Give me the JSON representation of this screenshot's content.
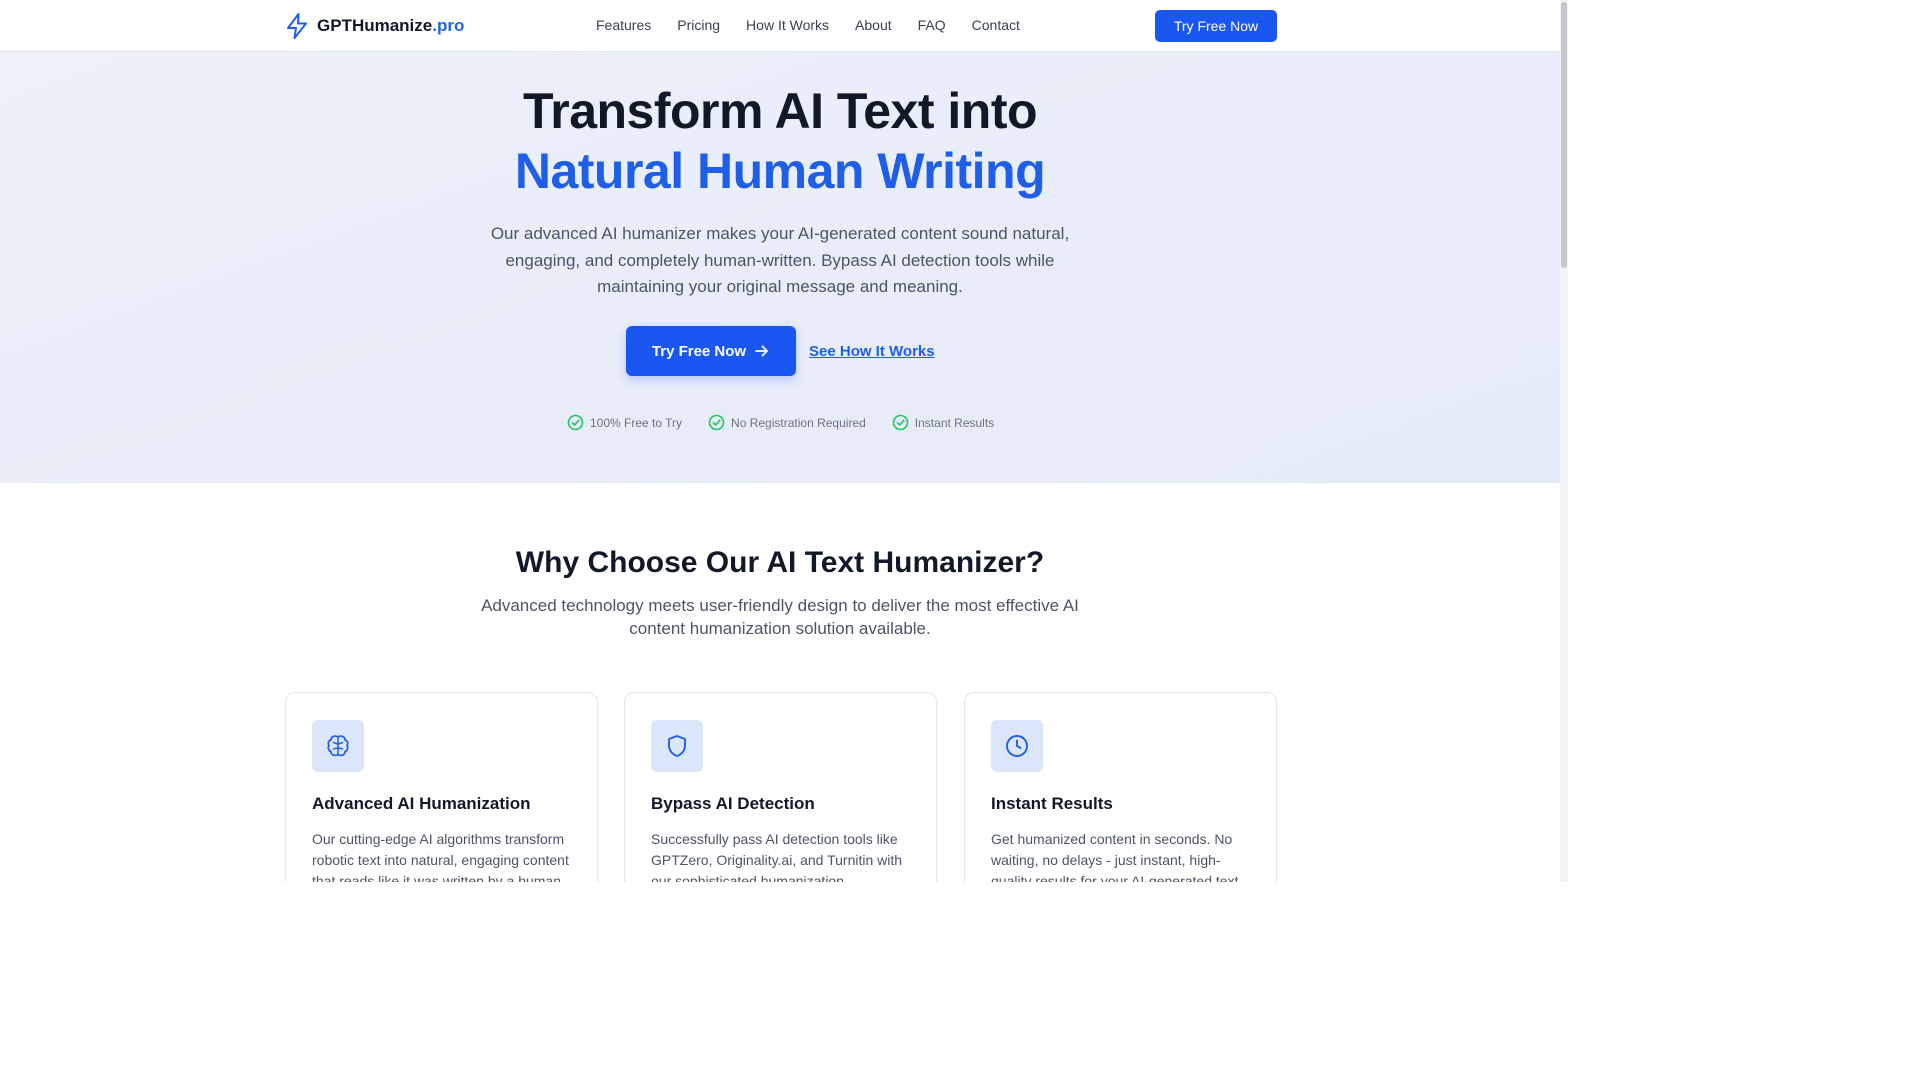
{
  "header": {
    "logo_main": "GPTHumanize",
    "logo_accent": ".pro",
    "logo_icon": "lightning-bolt-icon",
    "nav": [
      "Features",
      "Pricing",
      "How It Works",
      "About",
      "FAQ",
      "Contact"
    ],
    "cta": "Try Free Now"
  },
  "hero": {
    "title_line1": "Transform AI Text into",
    "title_line2": "Natural Human Writing",
    "description": "Our advanced AI humanizer makes your AI-generated content sound natural, engaging, and completely human-written. Bypass AI detection tools while maintaining your original message and meaning.",
    "primary_cta": "Try Free Now",
    "primary_cta_icon": "arrow-right-icon",
    "secondary_cta": "See How It Works",
    "badges": [
      "100% Free to Try",
      "No Registration Required",
      "Instant Results"
    ],
    "badge_icon": "check-circle-icon"
  },
  "features": {
    "title": "Why Choose Our AI Text Humanizer?",
    "subtitle": "Advanced technology meets user-friendly design to deliver the most effective AI content humanization solution available.",
    "cards": [
      {
        "icon": "brain-icon",
        "title": "Advanced AI Humanization",
        "text": "Our cutting-edge AI algorithms transform robotic text into natural, engaging content that reads like it was written by a human."
      },
      {
        "icon": "shield-icon",
        "title": "Bypass AI Detection",
        "text": "Successfully pass AI detection tools like GPTZero, Originality.ai, and Turnitin with our sophisticated humanization."
      },
      {
        "icon": "clock-icon",
        "title": "Instant Results",
        "text": "Get humanized content in seconds. No waiting, no delays - just instant, high-quality results for your AI-generated text."
      }
    ]
  },
  "colors": {
    "primary": "#1a56f0",
    "accent_text": "#1f5fe8",
    "check": "#22c55e",
    "icon_bg": "#dbe6fb"
  }
}
